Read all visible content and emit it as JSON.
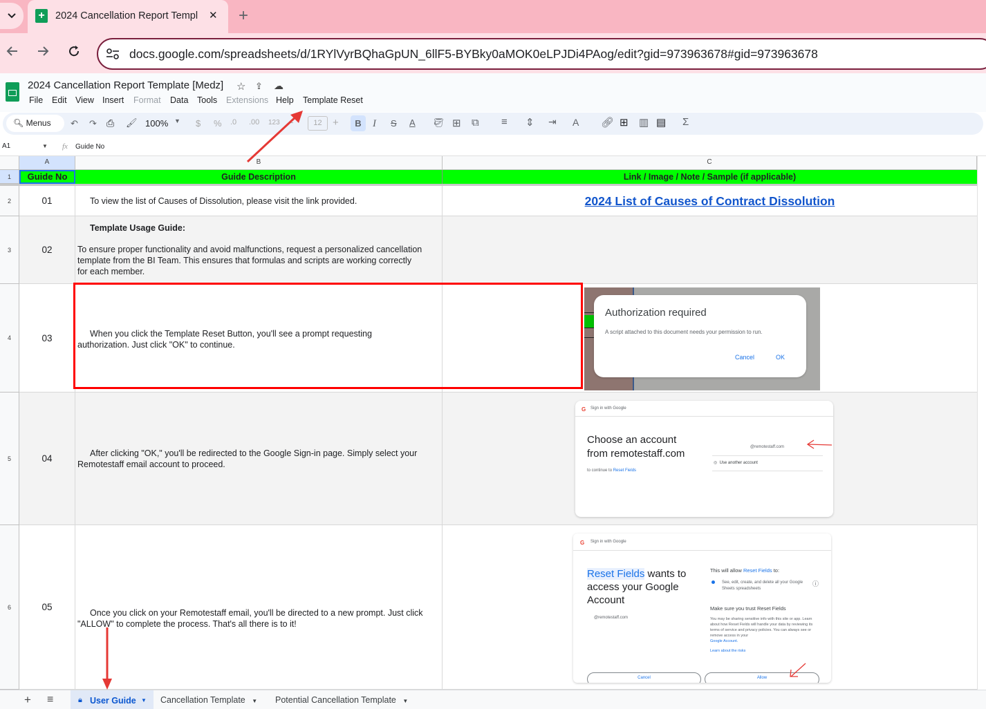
{
  "browser": {
    "tab_title": "2024 Cancellation Report Templ",
    "url": "docs.google.com/spreadsheets/d/1RYlVyrBQhaGpUN_6llF5-BYBky0aMOK0eLPJDi4PAog/edit?gid=973963678#gid=973963678",
    "new_tab": "+",
    "close": "✕"
  },
  "doc": {
    "title": "2024 Cancellation Report Template [Medz]",
    "menus": [
      "File",
      "Edit",
      "View",
      "Insert",
      "Format",
      "Data",
      "Tools",
      "Extensions",
      "Help",
      "Template Reset"
    ]
  },
  "toolbar": {
    "menus": "Menus",
    "zoom": "100%",
    "currency": "$",
    "percent": "%",
    "dec_down": ".0",
    "dec_up": ".00",
    "format123": "123",
    "font_size": "12",
    "bold": "B",
    "italic": "I",
    "strike": "S",
    "text_color": "A"
  },
  "formula": {
    "cell_ref": "A1",
    "fx": "fx",
    "content": "Guide No"
  },
  "columns": [
    "A",
    "B",
    "C"
  ],
  "header_row": {
    "row": "1",
    "a": "Guide No",
    "b": "Guide Description",
    "c": "Link / Image / Note / Sample (if applicable)"
  },
  "rows": [
    {
      "row": "2",
      "no": "01",
      "desc": "To view the list of Causes of Dissolution, please visit the link provided.",
      "link": "2024 List of Causes of Contract Dissolution"
    },
    {
      "row": "3",
      "no": "02",
      "title": "Template Usage Guide:",
      "desc": "To ensure proper functionality and avoid malfunctions, request a personalized cancellation template from the BI Team. This ensures that formulas and scripts are working correctly for each member."
    },
    {
      "row": "4",
      "no": "03",
      "desc": "When you click the Template Reset Button, you'll see a prompt requesting authorization. Just click \"OK\" to continue."
    },
    {
      "row": "5",
      "no": "04",
      "desc": "After clicking \"OK,\" you'll be redirected to the Google Sign-in page. Simply select your Remotestaff email account to proceed."
    },
    {
      "row": "6",
      "no": "05",
      "desc": "Once you click on your Remotestaff email, you'll be directed to a new prompt. Just click \"ALLOW\" to complete the process. That's all there is to it!"
    }
  ],
  "auth_dialog": {
    "title": "Authorization required",
    "body": "A script attached to this document needs your permission to run.",
    "cancel": "Cancel",
    "ok": "OK"
  },
  "signin": {
    "header": "Sign in with Google",
    "title1": "Choose an account",
    "title2": "from remotestaff.com",
    "continue_prefix": "to continue to ",
    "app": "Reset Fields",
    "account_email": "@remotestaff.com",
    "another": "Use another account"
  },
  "consent": {
    "header": "Sign in with Google",
    "app": "Reset Fields",
    "wants": " wants to access your Google Account",
    "email": "@remotestaff.com",
    "allow_intro": "This will allow ",
    "allow_intro2": " to:",
    "perm": "See, edit, create, and delete all your Google Sheets spreadsheets",
    "trust": "Make sure you trust Reset Fields",
    "fine": "You may be sharing sensitive info with this site or app. Learn about how Reset Fields will handle your data by reviewing its terms of service and privacy policies. You can always see or remove access in your",
    "google_account": "Google Account.",
    "learn": "Learn about the risks",
    "cancel": "Cancel",
    "allow": "Allow"
  },
  "sheets": {
    "active": "User Guide",
    "others": [
      "Cancellation Template",
      "Potential Cancellation Template"
    ]
  },
  "colors": {
    "header_green": "#00ff00",
    "highlight_red": "#ff0000",
    "link_blue": "#1155cc"
  }
}
